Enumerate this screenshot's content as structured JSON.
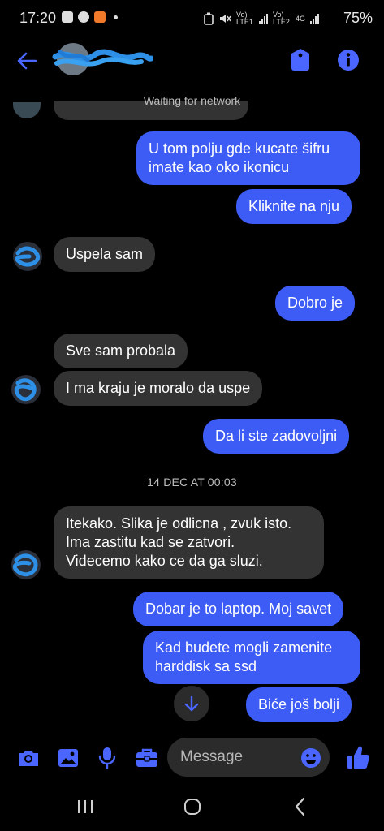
{
  "status_bar": {
    "time": "17:20",
    "battery": "75%",
    "network": [
      "Vo) LTE1",
      "Vo) LTE2",
      "4G"
    ]
  },
  "header": {
    "back_icon": "arrow-left-icon",
    "tag_icon": "tag-icon",
    "info_icon": "info-icon",
    "accent": "#3d5bf5"
  },
  "connection_status": "Waiting for network",
  "messages": [
    {
      "dir": "out",
      "text": "U tom polju gde kucate šifru\nimate kao oko ikonicu"
    },
    {
      "dir": "out",
      "text": "Kliknite na nju"
    },
    {
      "dir": "in",
      "text": "Uspela sam"
    },
    {
      "dir": "out",
      "text": "Dobro je"
    },
    {
      "dir": "in",
      "text": "Sve sam probala"
    },
    {
      "dir": "in",
      "text": "I ma kraju je moralo da uspe"
    },
    {
      "dir": "out",
      "text": "Da li ste zadovoljni"
    },
    {
      "dir": "in",
      "text": "Itekako. Slika je odlicna , zvuk isto.\nIma zastitu kad se zatvori.\nVidecemo kako ce da ga sluzi."
    },
    {
      "dir": "out",
      "text": "Dobar je to laptop. Moj savet"
    },
    {
      "dir": "out",
      "text": "Kad budete mogli zamenite\nharddisk sa ssd"
    },
    {
      "dir": "out",
      "text": "Biće još bolji"
    }
  ],
  "date_separator": "14 DEC AT 00:03",
  "composer": {
    "placeholder": "Message",
    "icons": [
      "camera-icon",
      "image-icon",
      "microphone-icon",
      "briefcase-icon",
      "emoji-icon",
      "thumbs-up-icon"
    ]
  },
  "colors": {
    "outgoing_bubble": "#3d5bf5",
    "incoming_bubble": "#333333",
    "background": "#000000"
  }
}
